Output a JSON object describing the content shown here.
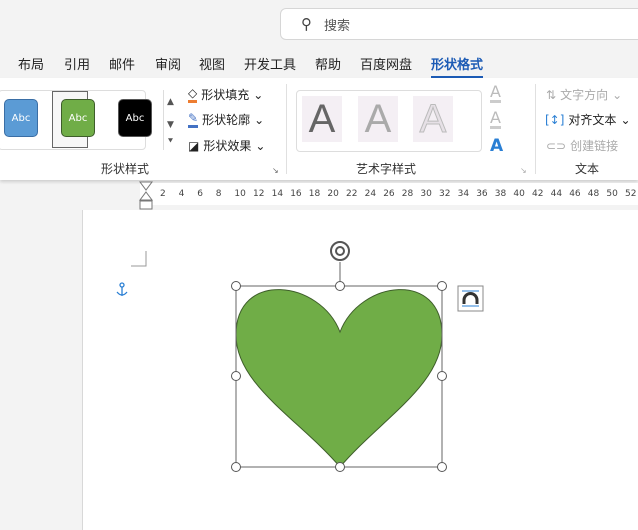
{
  "search": {
    "placeholder": "搜索",
    "icon": "search-icon"
  },
  "tabs": [
    {
      "label": "布局"
    },
    {
      "label": "引用"
    },
    {
      "label": "邮件"
    },
    {
      "label": "审阅"
    },
    {
      "label": "视图"
    },
    {
      "label": "开发工具"
    },
    {
      "label": "帮助"
    },
    {
      "label": "百度网盘"
    },
    {
      "label": "形状格式",
      "active": true
    }
  ],
  "shape_styles": {
    "swatches": [
      {
        "label": "Abc",
        "color": "#5b9bd5"
      },
      {
        "label": "Abc",
        "color": "#70ad47"
      },
      {
        "label": "Abc",
        "color": "#000000"
      }
    ],
    "fill": "形状填充",
    "outline": "形状轮廓",
    "effects": "形状效果",
    "group": "形状样式"
  },
  "wordart": {
    "letters": [
      "A",
      "A",
      "A"
    ],
    "group": "艺术字样式",
    "side": [
      "A",
      "A",
      "A"
    ]
  },
  "text": {
    "direction": "文字方向",
    "align": "对齐文本",
    "link": "创建链接",
    "group": "文本"
  },
  "ruler": [
    "2",
    "4",
    "6",
    "8",
    "10",
    "12",
    "14",
    "16",
    "18",
    "20",
    "22",
    "24",
    "26",
    "28",
    "30",
    "32",
    "34",
    "36",
    "38",
    "40",
    "42",
    "44",
    "46",
    "48",
    "50",
    "52"
  ],
  "shape": {
    "type": "heart",
    "fill": "#70ad47",
    "outline": "#3e5e2a"
  }
}
